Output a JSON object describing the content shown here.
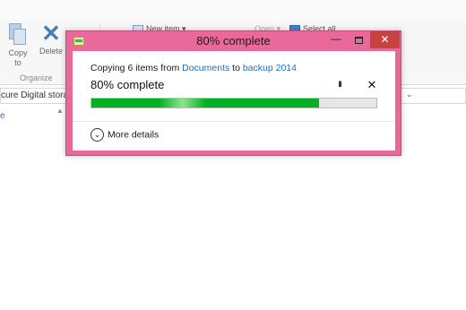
{
  "explorer": {
    "ribbon": {
      "copy_to_label": "Copy to",
      "delete_label": "Delete",
      "organize_label": "Organize",
      "new_item_label": "New item ▾",
      "open_label": "Open ▾",
      "select_all_label": "Select all"
    },
    "address_text": "cure Digital storag",
    "column_header": "e",
    "search_chevron": "⌄"
  },
  "dialog": {
    "title": "80% complete",
    "copy_prefix": "Copying 6 items from ",
    "source": "Documents",
    "to_word": " to ",
    "destination": "backup 2014",
    "status": "80% complete",
    "progress_percent": 80,
    "pause_glyph": "II",
    "cancel_glyph": "✕",
    "more_details_label": "More details",
    "more_details_glyph": "⌄",
    "minimize_glyph": "—",
    "close_glyph": "✕"
  },
  "colors": {
    "dialog_frame": "#e8699a",
    "progress_green": "#06b025",
    "close_red": "#c7433f",
    "link_blue": "#1f6fbd"
  }
}
